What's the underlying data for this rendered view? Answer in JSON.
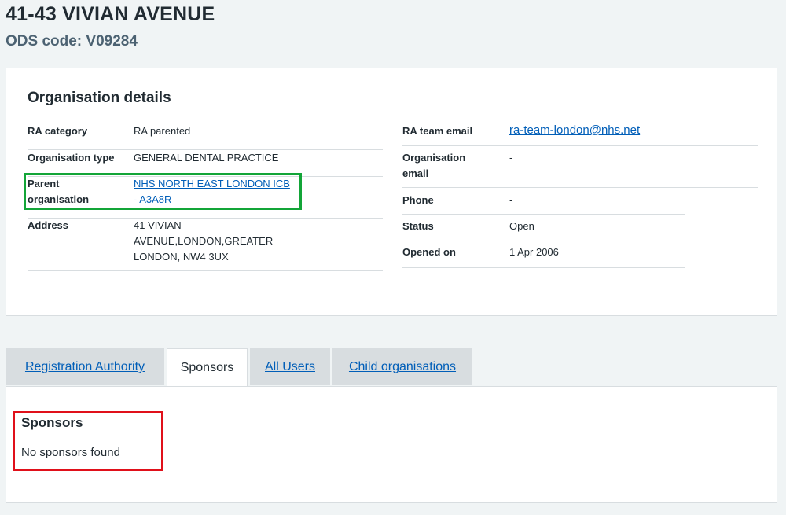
{
  "header": {
    "title": "41-43 VIVIAN AVENUE",
    "ods_code": "ODS code: V09284"
  },
  "details": {
    "heading": "Organisation details",
    "left": [
      {
        "key": "RA category",
        "value": "RA parented"
      },
      {
        "key": "Organisation type",
        "value": "GENERAL DENTAL PRACTICE"
      },
      {
        "key": "Parent organisation",
        "value": "NHS NORTH EAST LONDON ICB - A3A8R"
      },
      {
        "key": "Address",
        "value": "41 VIVIAN AVENUE,LONDON,GREATER LONDON, NW4 3UX"
      }
    ],
    "right": [
      {
        "key": "RA team email",
        "value": "ra-team-london@nhs.net"
      },
      {
        "key": "Organisation email",
        "value": "-"
      },
      {
        "key": "Phone",
        "value": "-"
      },
      {
        "key": "Status",
        "value": "Open"
      },
      {
        "key": "Opened on",
        "value": "1 Apr 2006"
      }
    ]
  },
  "tabs": [
    {
      "label": "Registration Authority",
      "active": false
    },
    {
      "label": "Sponsors",
      "active": true
    },
    {
      "label": "All Users",
      "active": false
    },
    {
      "label": "Child organisations",
      "active": false
    }
  ],
  "panel": {
    "heading": "Sponsors",
    "empty_message": "No sponsors found"
  },
  "colors": {
    "link": "#005eb8",
    "highlight_green": "#13a538",
    "highlight_red": "#e0101a"
  }
}
